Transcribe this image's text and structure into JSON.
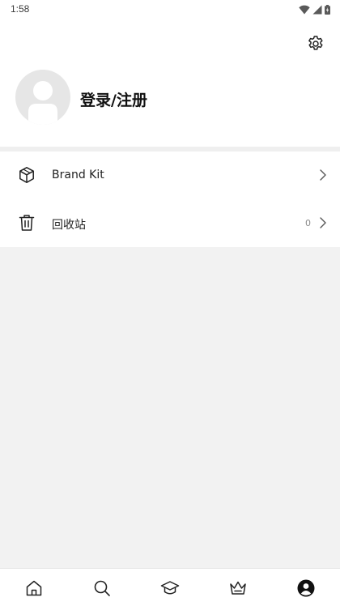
{
  "status_bar": {
    "time": "1:58"
  },
  "header": {
    "settings_icon": "gear-icon",
    "login_label": "登录/注册",
    "avatar_icon": "default-user-avatar"
  },
  "menu": {
    "items": [
      {
        "label": "Brand Kit",
        "icon": "package-box-icon",
        "count": ""
      },
      {
        "label": "回收站",
        "icon": "trash-icon",
        "count": "0"
      }
    ]
  },
  "bottom_nav": {
    "items": [
      {
        "icon": "home-icon",
        "active": false
      },
      {
        "icon": "search-icon",
        "active": false
      },
      {
        "icon": "graduation-cap-icon",
        "active": false
      },
      {
        "icon": "crown-icon",
        "active": false
      },
      {
        "icon": "profile-icon",
        "active": true
      }
    ]
  },
  "colors": {
    "background": "#ffffff",
    "content_background": "#f2f2f2",
    "divider": "#efefef",
    "text_primary": "#111111",
    "text_secondary": "#8a8a8a",
    "avatar_bg": "#e6e6e6"
  }
}
